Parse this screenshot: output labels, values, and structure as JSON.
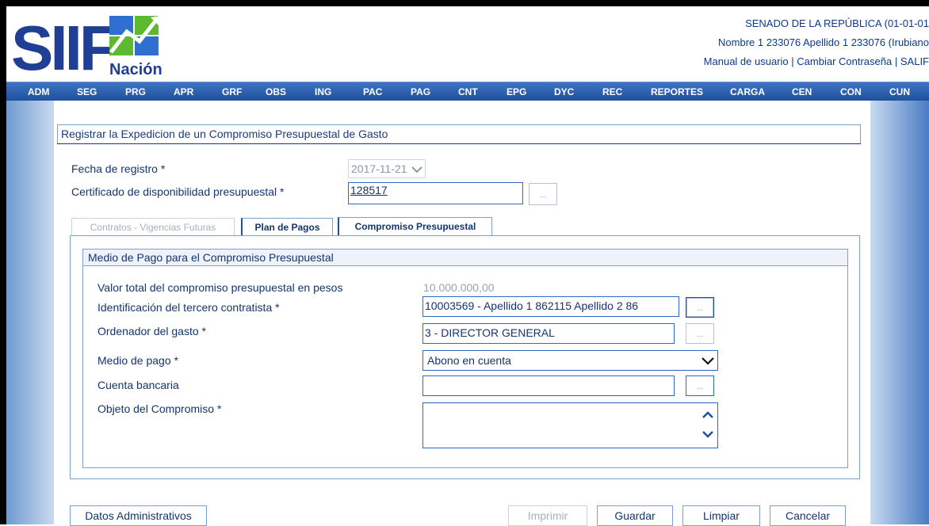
{
  "header": {
    "logo_main": "SIIF",
    "logo_sub": "Nación",
    "entity": "SENADO DE LA REPÚBLICA (01-01-01",
    "user": "Nombre 1 233076 Apellido 1 233076 (Irubiano",
    "links": [
      "Manual de usuario",
      "Cambiar Contraseña",
      "SALIF"
    ],
    "link_separator": "|"
  },
  "menu": [
    "ADM",
    "SEG",
    "PRG",
    "APR",
    "GRF",
    "OBS",
    "ING",
    "PAC",
    "PAG",
    "CNT",
    "EPG",
    "DYC",
    "REC",
    "REPORTES",
    "CARGA",
    "CEN",
    "CON",
    "CUN"
  ],
  "form": {
    "title": "Registrar la Expedicion de un Compromiso Presupuestal de Gasto",
    "fecha_label": "Fecha de registro *",
    "fecha_value": "2017-11-21",
    "cdp_label": "Certificado de disponibilidad presupuestal *",
    "cdp_value": "128517",
    "dots": "..."
  },
  "tabs": [
    {
      "label": "Contratos - Vigencias Futuras",
      "state": "disabled"
    },
    {
      "label": "Plan de Pagos",
      "state": "normal"
    },
    {
      "label": "Compromiso Presupuestal",
      "state": "active"
    }
  ],
  "panel": {
    "header": "Medio de Pago para el Compromiso Presupuestal",
    "valor_label": "Valor total del compromiso presupuestal en pesos",
    "valor_value": "10.000.000,00",
    "tercero_label": "Identificación del tercero contratista *",
    "tercero_value": "10003569 - Apellido 1 862115 Apellido 2 86",
    "ordenador_label": "Ordenador del gasto *",
    "ordenador_value": "3 - DIRECTOR GENERAL",
    "medio_label": "Medio de pago *",
    "medio_value": "Abono en cuenta",
    "cuenta_label": "Cuenta bancaria",
    "cuenta_value": "",
    "objeto_label": "Objeto del Compromiso *",
    "objeto_value": ""
  },
  "buttons": {
    "datos": "Datos Administrativos",
    "imprimir": "Imprimir",
    "guardar": "Guardar",
    "limpiar": "Limpiar",
    "cancelar": "Cancelar"
  },
  "colors": {
    "brand_blue": "#1d4f9a",
    "label_blue": "#14356d",
    "logo_green": "#5fb92e"
  }
}
